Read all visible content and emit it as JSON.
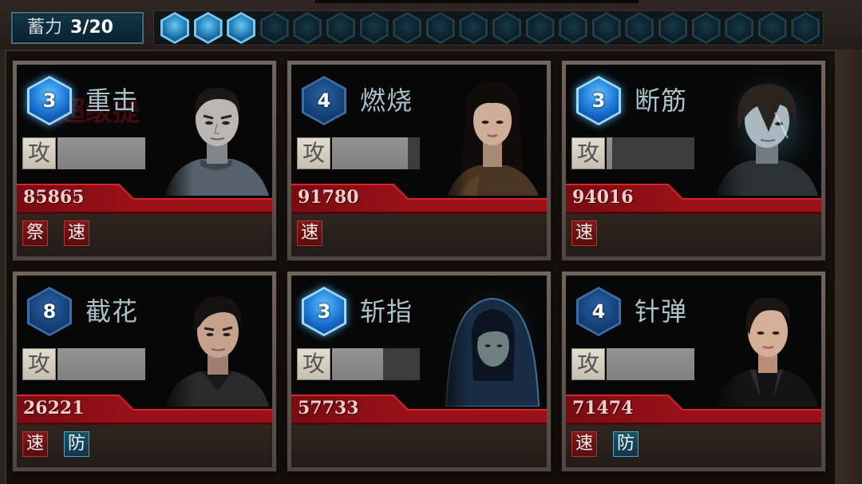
{
  "charge": {
    "label": "蓄力",
    "value": "3/20",
    "current": 3,
    "max": 20
  },
  "cards": [
    {
      "cost": 3,
      "name": "重击",
      "watermark": "超级提",
      "highlighted": true,
      "attack_label": "攻",
      "attack_fill": 1.0,
      "power": "85865",
      "tags": [
        {
          "text": "祭",
          "kind": "red"
        },
        {
          "text": "速",
          "kind": "red"
        }
      ]
    },
    {
      "cost": 4,
      "name": "燃烧",
      "highlighted": false,
      "attack_label": "攻",
      "attack_fill": 0.86,
      "power": "91780",
      "tags": [
        {
          "text": "速",
          "kind": "red"
        }
      ]
    },
    {
      "cost": 3,
      "name": "断筋",
      "highlighted": true,
      "attack_label": "攻",
      "attack_fill": 0.06,
      "power": "94016",
      "tags": [
        {
          "text": "速",
          "kind": "red"
        }
      ]
    },
    {
      "cost": 8,
      "name": "截花",
      "highlighted": false,
      "attack_label": "攻",
      "attack_fill": 1.0,
      "power": "26221",
      "tags": [
        {
          "text": "速",
          "kind": "red"
        },
        {
          "text": "防",
          "kind": "blue"
        }
      ]
    },
    {
      "cost": 3,
      "name": "斩指",
      "highlighted": true,
      "attack_label": "攻",
      "attack_fill": 0.58,
      "power": "57733",
      "tags": []
    },
    {
      "cost": 4,
      "name": "针弹",
      "highlighted": false,
      "attack_label": "攻",
      "attack_fill": 1.0,
      "power": "71474",
      "tags": [
        {
          "text": "速",
          "kind": "red"
        },
        {
          "text": "防",
          "kind": "blue"
        }
      ]
    }
  ],
  "colors": {
    "tag_red": "#c0302c",
    "tag_blue": "#4aa5cc",
    "gem_lit": "#74ccf4",
    "banner_red": "#9a1118"
  }
}
